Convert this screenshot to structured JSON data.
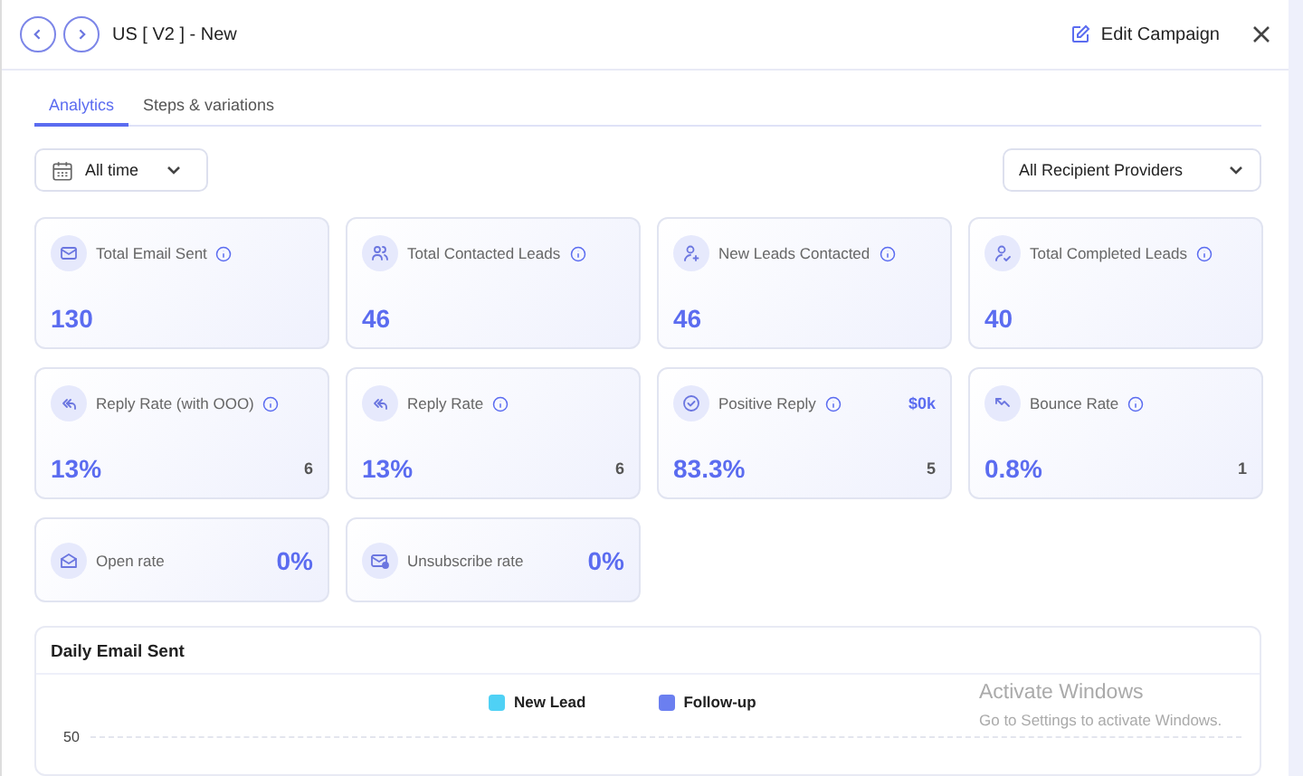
{
  "header": {
    "title": "US [ V2 ] - New",
    "edit_button": "Edit Campaign"
  },
  "tabs": [
    {
      "label": "Analytics",
      "selected": true
    },
    {
      "label": "Steps & variations",
      "selected": false
    }
  ],
  "filters": {
    "date_range": "All time",
    "provider": "All Recipient Providers"
  },
  "cards": [
    {
      "kind": "stat",
      "label": "Total Email Sent",
      "value": "130"
    },
    {
      "kind": "stat",
      "label": "Total Contacted Leads",
      "value": "46"
    },
    {
      "kind": "stat",
      "label": "New Leads Contacted",
      "value": "46"
    },
    {
      "kind": "stat",
      "label": "Total Completed Leads",
      "value": "40"
    },
    {
      "kind": "rate",
      "label": "Reply Rate (with OOO)",
      "value": "13%",
      "count": "6"
    },
    {
      "kind": "rate",
      "label": "Reply Rate",
      "value": "13%",
      "count": "6"
    },
    {
      "kind": "rate",
      "label": "Positive Reply",
      "value": "83.3%",
      "count": "5",
      "extra": "$0k"
    },
    {
      "kind": "rate",
      "label": "Bounce Rate",
      "value": "0.8%",
      "count": "1"
    },
    {
      "kind": "inline",
      "label": "Open rate",
      "value": "0%"
    },
    {
      "kind": "inline",
      "label": "Unsubscribe rate",
      "value": "0%"
    }
  ],
  "chart": {
    "title": "Daily Email Sent",
    "legend": [
      {
        "label": "New Lead",
        "color": "#4fd1f5"
      },
      {
        "label": "Follow-up",
        "color": "#6b7ff0"
      }
    ],
    "y_tick": "50"
  },
  "os_notice": {
    "title": "Activate Windows",
    "subtitle": "Go to Settings to activate Windows."
  }
}
